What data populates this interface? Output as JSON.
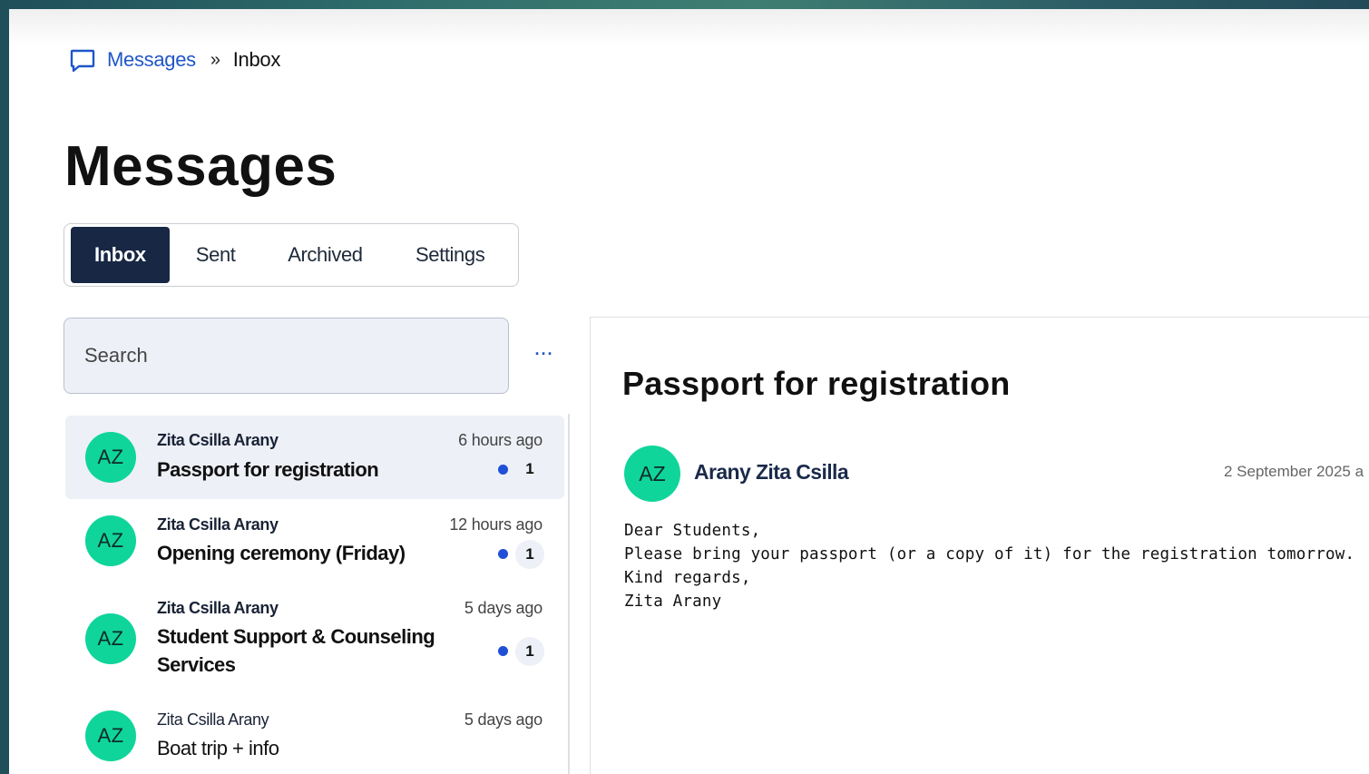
{
  "breadcrumb": {
    "icon": "message-square-icon",
    "root_label": "Messages",
    "separator": "»",
    "current_label": "Inbox"
  },
  "page_title": "Messages",
  "tabs": [
    {
      "label": "Inbox",
      "active": true
    },
    {
      "label": "Sent",
      "active": false
    },
    {
      "label": "Archived",
      "active": false
    },
    {
      "label": "Settings",
      "active": false
    }
  ],
  "search": {
    "placeholder": "Search",
    "value": ""
  },
  "more_menu_label": "···",
  "messages": [
    {
      "initials": "AZ",
      "sender": "Zita Csilla Arany",
      "subject": "Passport for registration",
      "time": "6 hours ago",
      "unread_count": "1",
      "unread": true,
      "selected": true
    },
    {
      "initials": "AZ",
      "sender": "Zita Csilla Arany",
      "subject": "Opening ceremony (Friday)",
      "time": "12 hours ago",
      "unread_count": "1",
      "unread": true,
      "selected": false
    },
    {
      "initials": "AZ",
      "sender": "Zita Csilla Arany",
      "subject": "Student Support & Counseling Services",
      "time": "5 days ago",
      "unread_count": "1",
      "unread": true,
      "selected": false
    },
    {
      "initials": "AZ",
      "sender": "Zita Csilla Arany",
      "subject": "Boat trip + info",
      "time": "5 days ago",
      "unread_count": "",
      "unread": false,
      "selected": false
    }
  ],
  "detail": {
    "title": "Passport for registration",
    "initials": "AZ",
    "sender": "Arany Zita Csilla",
    "date": "2 September 2025 a",
    "body": [
      "Dear Students,",
      "Please bring your passport (or a copy of it) for the registration tomorrow.",
      "Kind regards,",
      "Zita Arany"
    ]
  },
  "colors": {
    "accent": "#1f56c8",
    "active_tab": "#172744",
    "avatar": "#10d59b",
    "unread_dot": "#1f4fd6",
    "selected_row": "#eef0f7"
  }
}
